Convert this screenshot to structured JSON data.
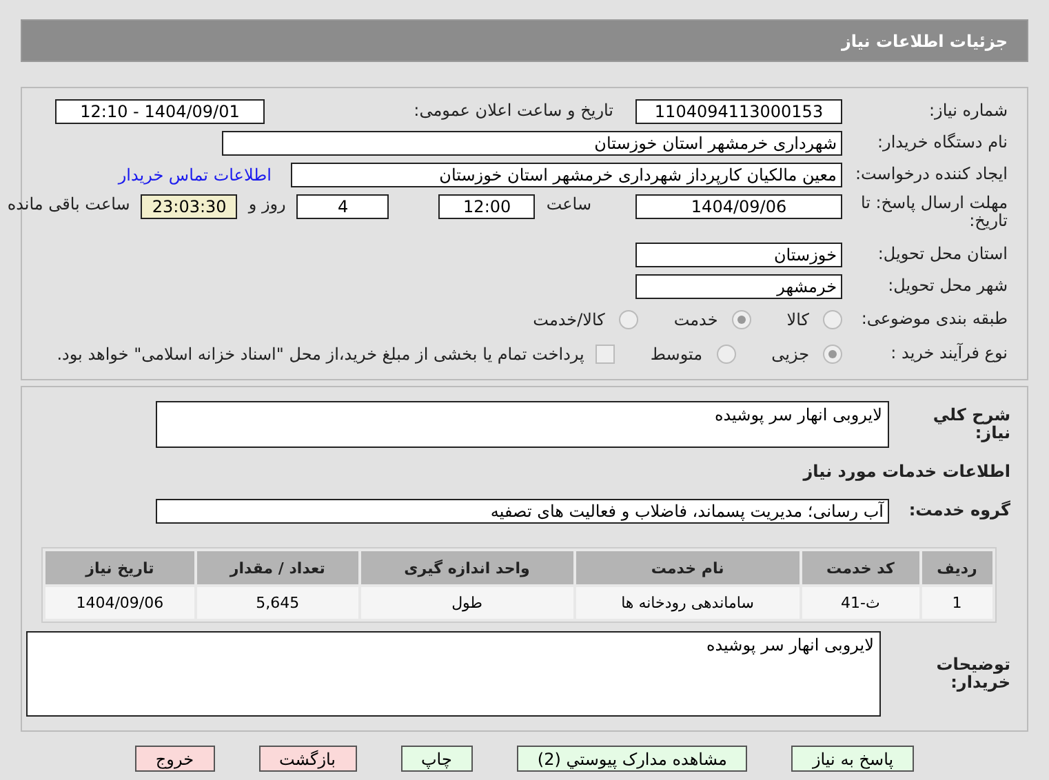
{
  "header": {
    "title": "جزئیات اطلاعات نیاز"
  },
  "details": {
    "need_number": {
      "label": "شماره نیاز:",
      "value": "1104094113000153"
    },
    "announce": {
      "label": "تاریخ و ساعت اعلان عمومی:",
      "value": "1404/09/01 - 12:10"
    },
    "buyer_org": {
      "label": "نام دستگاه خریدار:",
      "value": "شهرداری خرمشهر استان خوزستان"
    },
    "requester": {
      "label": "ایجاد کننده درخواست:",
      "value": "معین مالکیان کارپرداز شهرداری خرمشهر استان خوزستان",
      "link": "اطلاعات تماس خریدار"
    },
    "deadline": {
      "label": "مهلت ارسال پاسخ: تا تاریخ:",
      "date": "1404/09/06",
      "time_label": "ساعت",
      "time": "12:00",
      "days": "4",
      "days_label": "روز و",
      "remaining": "23:03:30",
      "remaining_label": "ساعت باقی مانده"
    },
    "province": {
      "label": "استان محل تحویل:",
      "value": "خوزستان"
    },
    "city": {
      "label": "شهر محل تحویل:",
      "value": "خرمشهر"
    },
    "category": {
      "label": "طبقه بندی موضوعی:",
      "options": [
        {
          "label": "کالا",
          "selected": false
        },
        {
          "label": "خدمت",
          "selected": true
        },
        {
          "label": "کالا/خدمت",
          "selected": false
        }
      ]
    },
    "process": {
      "label": "نوع فرآیند خرید :",
      "options": [
        {
          "label": "جزیی",
          "selected": true
        },
        {
          "label": "متوسط",
          "selected": false
        }
      ],
      "payment": {
        "checked": false,
        "text": "پرداخت تمام یا بخشی از مبلغ خرید،از محل \"اسناد خزانه اسلامی\" خواهد بود."
      }
    }
  },
  "services": {
    "summary": {
      "label": "شرح کلي نياز:",
      "value": "لایروبی انهار سر پوشیده"
    },
    "section_title": "اطلاعات خدمات مورد نیاز",
    "group": {
      "label": "گروه خدمت:",
      "value": "آب رسانی؛ مدیریت پسماند، فاضلاب و فعالیت های تصفیه"
    },
    "table": {
      "columns": [
        "ردیف",
        "کد خدمت",
        "نام خدمت",
        "واحد اندازه گیری",
        "تعداد / مقدار",
        "تاریخ نیاز"
      ],
      "rows": [
        [
          "1",
          "ث-41",
          "ساماندهی رودخانه ها",
          "طول",
          "5,645",
          "1404/09/06"
        ]
      ]
    },
    "notes": {
      "label": "توضیحات خریدار:",
      "value": "لایروبی انهار سر پوشیده"
    }
  },
  "buttons": [
    {
      "label": "پاسخ به نیاز",
      "kind": "green"
    },
    {
      "label": "مشاهده مدارک پیوستي (2)",
      "kind": "green"
    },
    {
      "label": "چاپ",
      "kind": "green"
    },
    {
      "label": "بازگشت",
      "kind": "red"
    },
    {
      "label": "خروج",
      "kind": "red"
    }
  ]
}
